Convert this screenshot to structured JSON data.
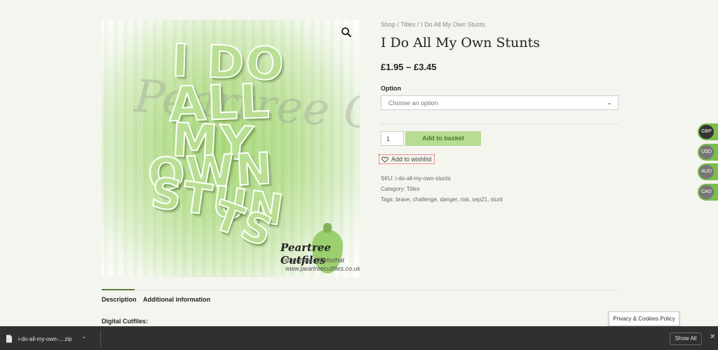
{
  "product_image": {
    "artwork_words": [
      "I DO",
      "ALL",
      "MY",
      "OWN",
      "STUN",
      "TS"
    ],
    "watermark": "Peartree Cutfiles",
    "brand_name": "Peartree Cutfiles",
    "brand_tagline": "#thereisacutfileforthat",
    "brand_url": "www.peartreecutfiles.co.uk",
    "zoom_icon": "magnifier-icon"
  },
  "breadcrumb": [
    "Shop",
    "Titles",
    "I Do All My Own Stunts"
  ],
  "breadcrumb_separator": " / ",
  "product": {
    "title": "I Do All My Own Stunts",
    "price": "£1.95 – £3.45"
  },
  "option": {
    "label": "Option",
    "placeholder": "Choose an option"
  },
  "cart": {
    "quantity": "1",
    "add_label": "Add to basket"
  },
  "wishlist": {
    "label": "Add to wishlist",
    "icon": "heart-outline-icon"
  },
  "meta": {
    "sku": "SKU: i-do-all-my-own-stunts",
    "category": "Category: Titles",
    "tags": "Tags: brave, challenge, danger, risk, sep21, stunt"
  },
  "currencies": [
    {
      "code": "GBP",
      "active": true
    },
    {
      "code": "USD",
      "active": false
    },
    {
      "code": "AUD",
      "active": false
    },
    {
      "code": "CAD",
      "active": false
    }
  ],
  "tabs": [
    {
      "label": "Description",
      "active": true
    },
    {
      "label": "Additional information",
      "active": false
    }
  ],
  "section_heading": "Digital Cutfiles:",
  "privacy_button": "Privacy & Cookies Policy",
  "download_bar": {
    "file_name": "i-do-all-my-own-....zip",
    "show_all": "Show All"
  },
  "colors": {
    "accent_green": "#b7dc93",
    "currency_green": "#7dbb4d",
    "tab_bar": "#5a7f3a"
  }
}
